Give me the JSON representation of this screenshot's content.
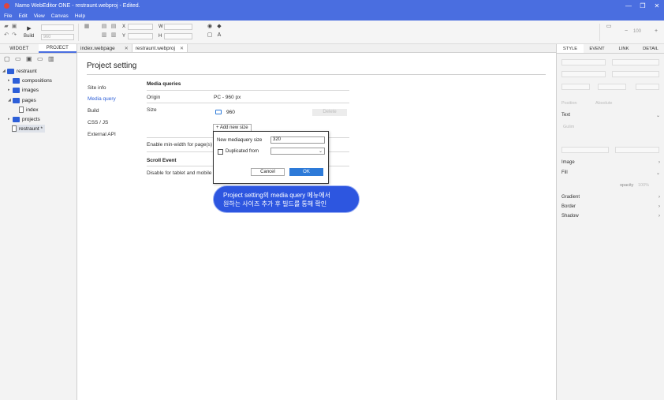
{
  "window": {
    "title": "Namo WebEditor ONE - restraunt.webproj - Edited.",
    "controls": [
      "—",
      "❐",
      "✕"
    ]
  },
  "menu": [
    "File",
    "Edit",
    "View",
    "Canvas",
    "Help"
  ],
  "toolbar": {
    "build_label": "Build",
    "width_value": "960",
    "x_label": "X",
    "y_label": "Y",
    "w_label": "W",
    "h_label": "H",
    "zoom_value": "100"
  },
  "left_panel": {
    "tabs": [
      "WIDGET",
      "PROJECT"
    ],
    "tree": {
      "root": "restraunt",
      "items": [
        "compositions",
        "images",
        "pages",
        "index",
        "projects",
        "restraunt *"
      ]
    }
  },
  "doc_tabs": [
    "index.webpage",
    "restraunt.webproj"
  ],
  "project_setting": {
    "title": "Project setting",
    "nav": [
      "Site info",
      "Media query",
      "Build",
      "CSS / JS",
      "External API"
    ],
    "media_queries": {
      "heading": "Media queries",
      "origin_label": "Origin",
      "origin_value": "PC - 960 px",
      "size_label": "Size",
      "size_value": "960",
      "delete_label": "Delete",
      "add_label": "+ Add new size"
    },
    "enable_minwidth_label": "Enable min-width for page(s)",
    "scroll_event": {
      "heading": "Scroll Event",
      "disable_label": "Disable for tablet and mobile"
    }
  },
  "popup": {
    "new_size_label": "New mediaquery size",
    "new_size_value": "320",
    "duplicated_label": "Duplicated from",
    "cancel_label": "Cancel",
    "ok_label": "OK"
  },
  "callout": {
    "line1": "Project setting의 media query 메뉴에서",
    "line2": "원하는 사이즈 추가 후 빌드를 통해 확인"
  },
  "right_panel": {
    "tabs": [
      "STYLE",
      "EVENT",
      "LINK",
      "DETAIL"
    ],
    "position_label": "Position",
    "position_value": "Absolute",
    "text_label": "Text",
    "font_value": "Gulim",
    "image_label": "Image",
    "fill_label": "Fill",
    "opacity_label": "opacity",
    "opacity_value": "100%",
    "gradient_label": "Gradient",
    "border_label": "Border",
    "shadow_label": "Shadow"
  },
  "colors": {
    "accent": "#4a6ee0",
    "link": "#2d5fd8",
    "ok_button": "#2d7ad8",
    "callout": "#2d56e0"
  }
}
